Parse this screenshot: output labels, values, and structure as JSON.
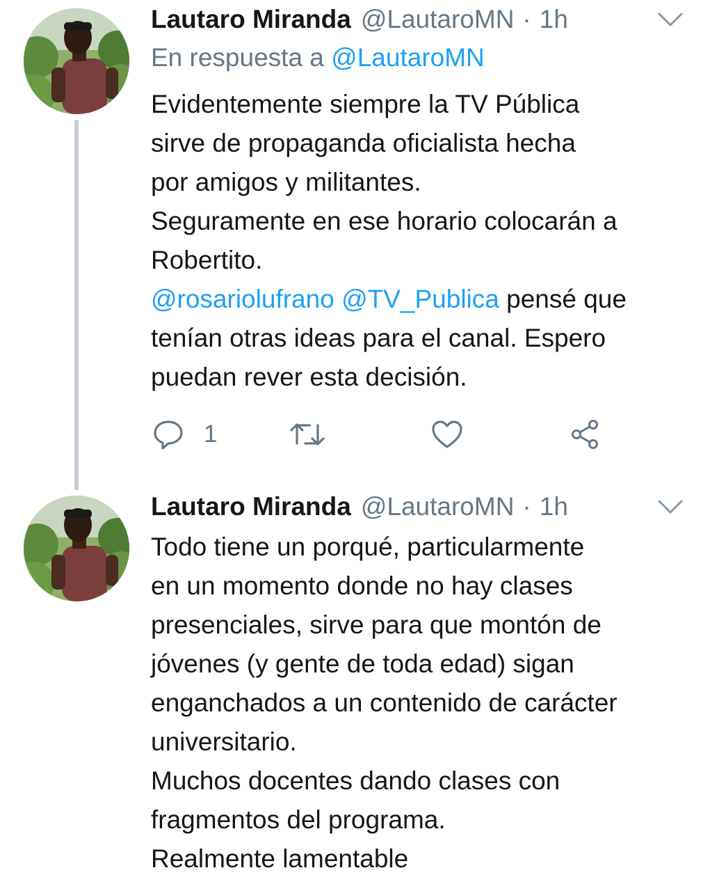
{
  "tweets": [
    {
      "author_name": "Lautaro Miranda",
      "author_handle": "@LautaroMN",
      "separator": "·",
      "time": "1h",
      "reply_prefix": "En respuesta a",
      "reply_to": "@LautaroMN",
      "lines": {
        "l1": "Evidentemente siempre la TV Pública",
        "l2": "sirve de propaganda oficialista hecha",
        "l3": "por amigos y militantes.",
        "l4": "Seguramente en ese horario colocarán a",
        "l5": "Robertito.",
        "l6_mention1": "@rosariolufrano",
        "l6_mention2": "@TV_Publica",
        "l6_rest": " pensé que",
        "l7": "tenían otras ideas para el canal. Espero",
        "l8": "puedan rever esta decisión."
      },
      "reply_count": "1",
      "icons": [
        "reply-icon",
        "retweet-icon",
        "like-icon",
        "share-icon",
        "chevron-down-icon"
      ]
    },
    {
      "author_name": "Lautaro Miranda",
      "author_handle": "@LautaroMN",
      "separator": "·",
      "time": "1h",
      "lines": {
        "l1": "Todo tiene un porqué, particularmente",
        "l2": "en un momento donde no hay clases",
        "l3": "presenciales, sirve para que montón de",
        "l4": "jóvenes (y gente de toda edad) sigan",
        "l5": "enganchados a un contenido de carácter",
        "l6": "universitario.",
        "l7": "Muchos docentes dando clases con",
        "l8": "fragmentos del programa.",
        "l9": "Realmente lamentable"
      },
      "icons": [
        "chevron-down-icon"
      ]
    }
  ],
  "colors": {
    "text": "#14171a",
    "secondary": "#657786",
    "link": "#1da1f2",
    "thread_line": "#c5cdd4"
  }
}
